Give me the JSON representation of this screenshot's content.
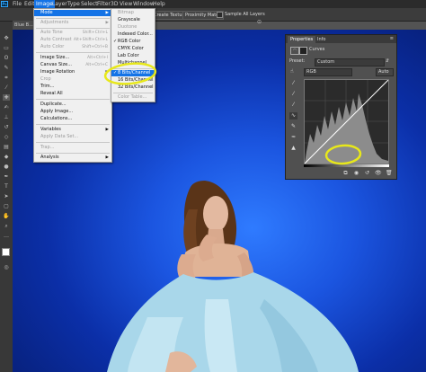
{
  "app": {
    "logo": "Ps"
  },
  "menubar": [
    "File",
    "Edit",
    "Image",
    "Layer",
    "Type",
    "Select",
    "Filter",
    "3D",
    "View",
    "Window",
    "Help"
  ],
  "options": {
    "create_texture": "Create Texture",
    "proximity_match": "Proximity Match",
    "sample_all_layers": "Sample All Layers"
  },
  "doc_tab": {
    "label": "Blue B..."
  },
  "image_menu": {
    "items": [
      {
        "label": "Mode",
        "shortcut": "",
        "arrow": "▶",
        "state": "hi"
      },
      {
        "label": "Adjustments",
        "shortcut": "",
        "arrow": "▶",
        "state": "dis"
      },
      {
        "label": "Auto Tone",
        "shortcut": "Shift+Ctrl+L",
        "arrow": "",
        "state": "dis"
      },
      {
        "label": "Auto Contrast",
        "shortcut": "Alt+Shift+Ctrl+L",
        "arrow": "",
        "state": "dis"
      },
      {
        "label": "Auto Color",
        "shortcut": "Shift+Ctrl+B",
        "arrow": "",
        "state": "dis"
      },
      {
        "label": "Image Size...",
        "shortcut": "Alt+Ctrl+I",
        "arrow": "",
        "state": ""
      },
      {
        "label": "Canvas Size...",
        "shortcut": "Alt+Ctrl+C",
        "arrow": "",
        "state": ""
      },
      {
        "label": "Image Rotation",
        "shortcut": "",
        "arrow": "▶",
        "state": ""
      },
      {
        "label": "Crop",
        "shortcut": "",
        "arrow": "",
        "state": "dis"
      },
      {
        "label": "Trim...",
        "shortcut": "",
        "arrow": "",
        "state": ""
      },
      {
        "label": "Reveal All",
        "shortcut": "",
        "arrow": "",
        "state": ""
      },
      {
        "label": "Duplicate...",
        "shortcut": "",
        "arrow": "",
        "state": ""
      },
      {
        "label": "Apply Image...",
        "shortcut": "",
        "arrow": "",
        "state": ""
      },
      {
        "label": "Calculations...",
        "shortcut": "",
        "arrow": "",
        "state": ""
      },
      {
        "label": "Variables",
        "shortcut": "",
        "arrow": "▶",
        "state": ""
      },
      {
        "label": "Apply Data Set...",
        "shortcut": "",
        "arrow": "",
        "state": "dis"
      },
      {
        "label": "Trap...",
        "shortcut": "",
        "arrow": "",
        "state": "dis"
      },
      {
        "label": "Analysis",
        "shortcut": "",
        "arrow": "▶",
        "state": ""
      }
    ]
  },
  "mode_menu": {
    "items": [
      {
        "label": "Bitmap",
        "state": "dis",
        "checked": false
      },
      {
        "label": "Grayscale",
        "state": "",
        "checked": false
      },
      {
        "label": "Duotone",
        "state": "dis",
        "checked": false
      },
      {
        "label": "Indexed Color...",
        "state": "",
        "checked": false
      },
      {
        "label": "RGB Color",
        "state": "",
        "checked": true
      },
      {
        "label": "CMYK Color",
        "state": "",
        "checked": false
      },
      {
        "label": "Lab Color",
        "state": "",
        "checked": false
      },
      {
        "label": "Multichannel",
        "state": "",
        "checked": false
      },
      {
        "label": "8 Bits/Channel",
        "state": "hi",
        "checked": true
      },
      {
        "label": "16 Bits/Channel",
        "state": "",
        "checked": false
      },
      {
        "label": "32 Bits/Channel",
        "state": "",
        "checked": false
      },
      {
        "label": "Color Table...",
        "state": "dis",
        "checked": false
      }
    ]
  },
  "properties": {
    "tab1": "Properties",
    "tab2": "Info",
    "adjustment": "Curves",
    "preset_label": "Preset:",
    "preset_value": "Custom",
    "channel_value": "RGB",
    "auto_button": "Auto"
  },
  "colors": {
    "menu_highlight": "#1473e6",
    "annotation": "#e8e81a",
    "canvas_blue": "#1b55e0"
  }
}
